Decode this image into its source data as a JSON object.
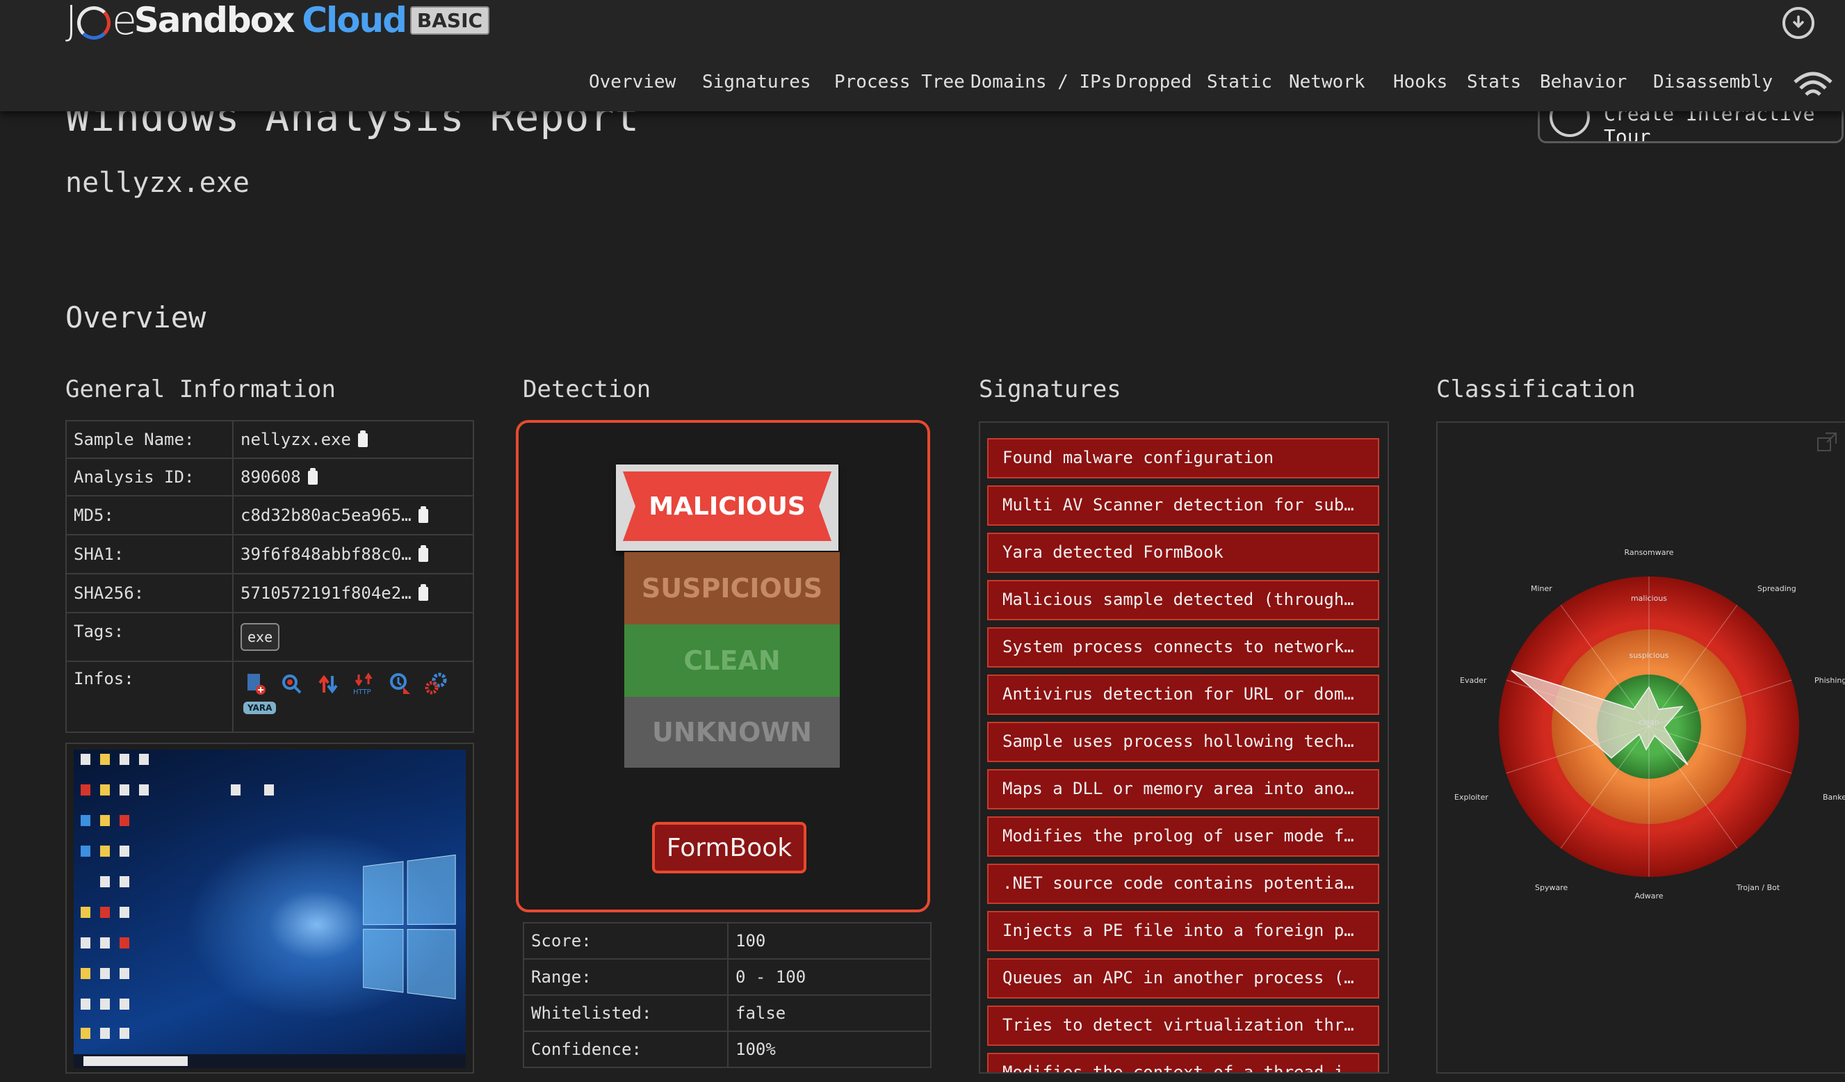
{
  "header": {
    "logo_joe": "J",
    "logo_joe2": "e",
    "logo_sandbox": "Sandbox",
    "logo_cloud": "Cloud",
    "logo_badge": "BASIC",
    "nav": [
      "Overview",
      "Signatures",
      "Process Tree",
      "Domains / IPs",
      "Dropped",
      "Static",
      "Network",
      "Hooks",
      "Stats",
      "Behavior",
      "Disassembly"
    ]
  },
  "report": {
    "title": "Windows Analysis Report",
    "tour_button": "Create Interactive Tour",
    "sample": "nellyzx.exe",
    "overview_heading": "Overview"
  },
  "sections": {
    "general": "General Information",
    "detection": "Detection",
    "signatures": "Signatures",
    "classification": "Classification"
  },
  "general_info": {
    "rows": [
      {
        "key": "Sample Name:",
        "value": "nellyzx.exe"
      },
      {
        "key": "Analysis ID:",
        "value": "890608"
      },
      {
        "key": "MD5:",
        "value": "c8d32b80ac5ea965…"
      },
      {
        "key": "SHA1:",
        "value": "39f6f848abbf88c0…"
      },
      {
        "key": "SHA256:",
        "value": "5710572191f804e2…"
      }
    ],
    "tags_label": "Tags:",
    "tag": "exe",
    "infos_label": "Infos:",
    "yara_badge": "YARA",
    "info_icons": [
      "document-add-icon",
      "magnifier-icon",
      "upload-arrow-icon",
      "http-icon",
      "alert-search-icon",
      "gears-icon"
    ]
  },
  "detection": {
    "levels": {
      "malicious": "MALICIOUS",
      "suspicious": "SUSPICIOUS",
      "clean": "CLEAN",
      "unknown": "UNKNOWN"
    },
    "active_level": "malicious",
    "family": "FormBook",
    "score_rows": [
      {
        "key": "Score:",
        "value": "100"
      },
      {
        "key": "Range:",
        "value": "0 - 100"
      },
      {
        "key": "Whitelisted:",
        "value": "false"
      },
      {
        "key": "Confidence:",
        "value": "100%"
      }
    ],
    "colors": {
      "malicious": "#e8453c",
      "suspicious": "#8e4f2c",
      "clean": "#3f8a3c",
      "unknown": "#5c5c5c",
      "accent": "#e64a2f"
    }
  },
  "signatures": [
    "Found malware configuration",
    "Multi AV Scanner detection for submitte…",
    "Yara detected FormBook",
    "Malicious sample detected (through comm…",
    "System process connects to network (lik…",
    "Antivirus detection for URL or domain",
    "Sample uses process hollowing technique",
    "Maps a DLL or memory area into another …",
    "Modifies the prolog of user mode functi…",
    ".NET source code contains potential unp…",
    "Injects a PE file into a foreign proces…",
    "Queues an APC in another process (threa…",
    "Tries to detect virtualization through …",
    "Modifies the context of a thread in ano…"
  ],
  "classification": {
    "labels": [
      "Ransomware",
      "Spreading",
      "Phishing",
      "Banker",
      "Trojan / Bot",
      "Adware",
      "Spyware",
      "Exploiter",
      "Evader",
      "Miner"
    ],
    "rings": [
      "malicious",
      "suspicious",
      "clean"
    ],
    "colors": {
      "outer": "#c21d16",
      "middle": "#e07a34",
      "inner": "#3f9a3a"
    }
  }
}
